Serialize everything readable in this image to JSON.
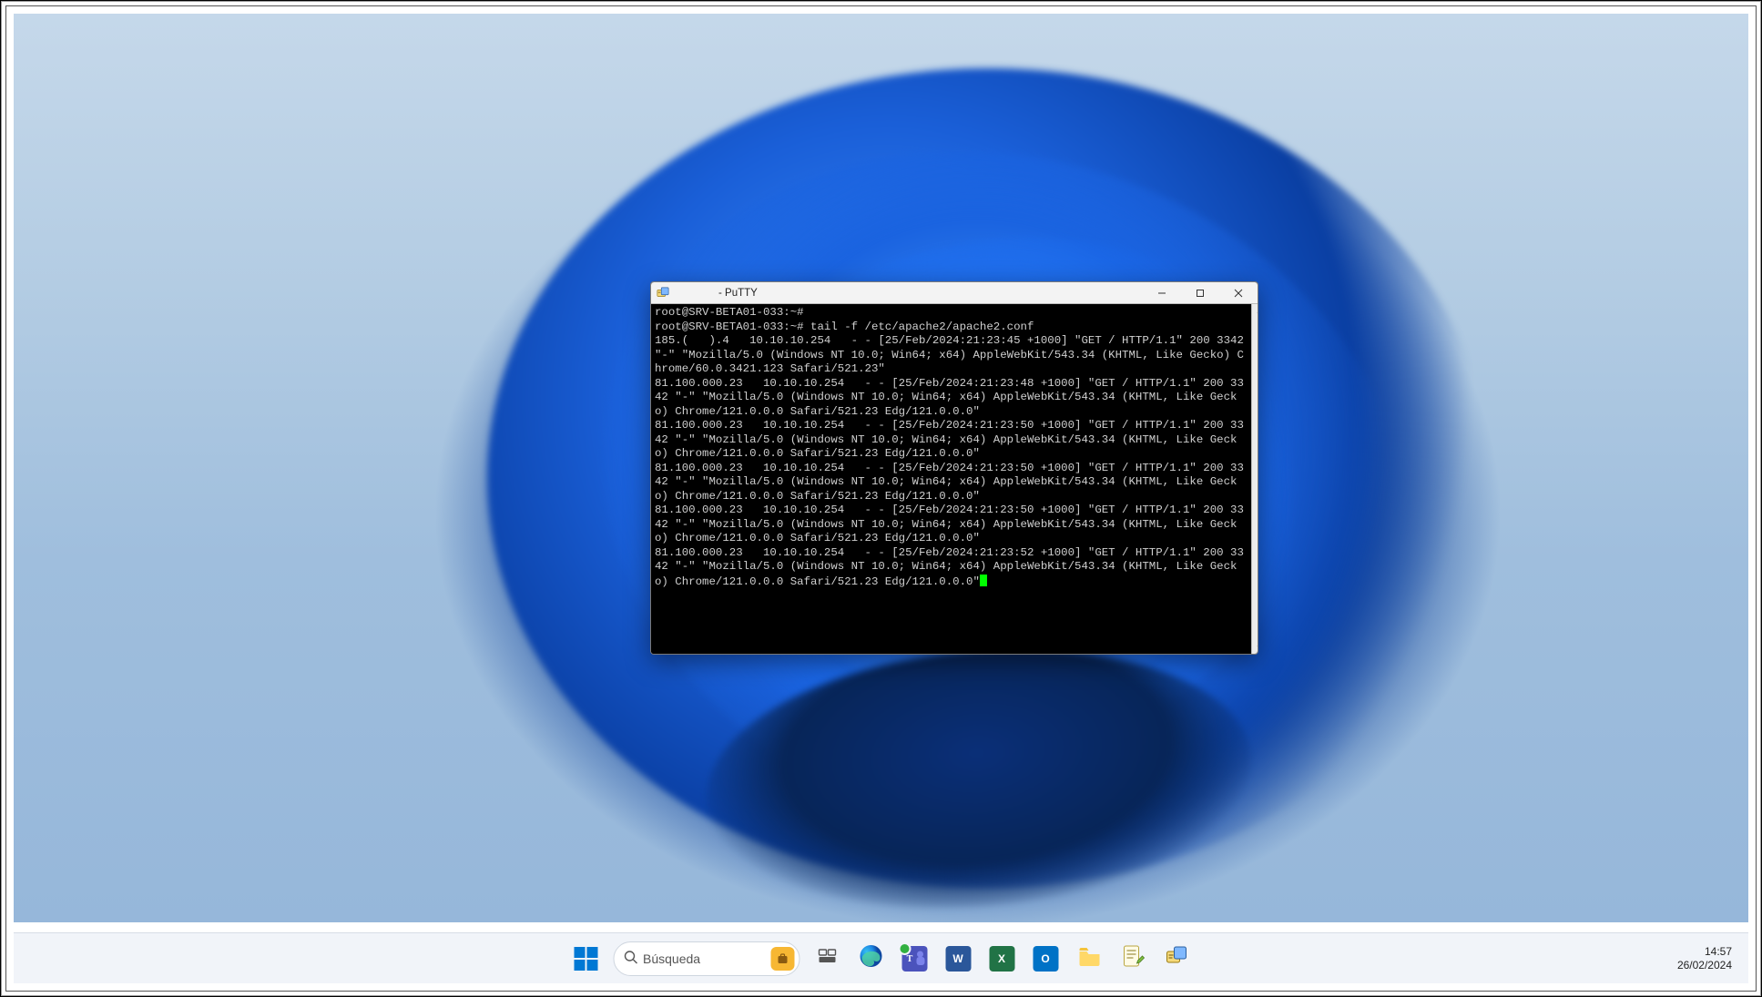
{
  "putty": {
    "title": "- PuTTY",
    "terminal_text": "root@SRV-BETA01-033:~#\nroot@SRV-BETA01-033:~# tail -f /etc/apache2/apache2.conf\n185.(   ).4   10.10.10.254   - - [25/Feb/2024:21:23:45 +1000] \"GET / HTTP/1.1\" 200 3342 \"-\" \"Mozilla/5.0 (Windows NT 10.0; Win64; x64) AppleWebKit/543.34 (KHTML, Like Gecko) Chrome/60.0.3421.123 Safari/521.23\"\n81.100.000.23   10.10.10.254   - - [25/Feb/2024:21:23:48 +1000] \"GET / HTTP/1.1\" 200 3342 \"-\" \"Mozilla/5.0 (Windows NT 10.0; Win64; x64) AppleWebKit/543.34 (KHTML, Like Gecko) Chrome/121.0.0.0 Safari/521.23 Edg/121.0.0.0\"\n81.100.000.23   10.10.10.254   - - [25/Feb/2024:21:23:50 +1000] \"GET / HTTP/1.1\" 200 3342 \"-\" \"Mozilla/5.0 (Windows NT 10.0; Win64; x64) AppleWebKit/543.34 (KHTML, Like Gecko) Chrome/121.0.0.0 Safari/521.23 Edg/121.0.0.0\"\n81.100.000.23   10.10.10.254   - - [25/Feb/2024:21:23:50 +1000] \"GET / HTTP/1.1\" 200 3342 \"-\" \"Mozilla/5.0 (Windows NT 10.0; Win64; x64) AppleWebKit/543.34 (KHTML, Like Gecko) Chrome/121.0.0.0 Safari/521.23 Edg/121.0.0.0\"\n81.100.000.23   10.10.10.254   - - [25/Feb/2024:21:23:50 +1000] \"GET / HTTP/1.1\" 200 3342 \"-\" \"Mozilla/5.0 (Windows NT 10.0; Win64; x64) AppleWebKit/543.34 (KHTML, Like Gecko) Chrome/121.0.0.0 Safari/521.23 Edg/121.0.0.0\"\n81.100.000.23   10.10.10.254   - - [25/Feb/2024:21:23:52 +1000] \"GET / HTTP/1.1\" 200 3342 \"-\" \"Mozilla/5.0 (Windows NT 10.0; Win64; x64) AppleWebKit/543.34 (KHTML, Like Gecko) Chrome/121.0.0.0 Safari/521.23 Edg/121.0.0.0\""
  },
  "taskbar": {
    "search_placeholder": "Búsqueda",
    "apps": {
      "task_view": "Task View",
      "edge": "Edge",
      "teams": "Teams",
      "word": "W",
      "excel": "X",
      "outlook": "O",
      "explorer": "Explorer",
      "notepadpp": "Notepad++",
      "putty": "PuTTY"
    }
  },
  "tray": {
    "time": "14:57",
    "date": "26/02/2024"
  }
}
